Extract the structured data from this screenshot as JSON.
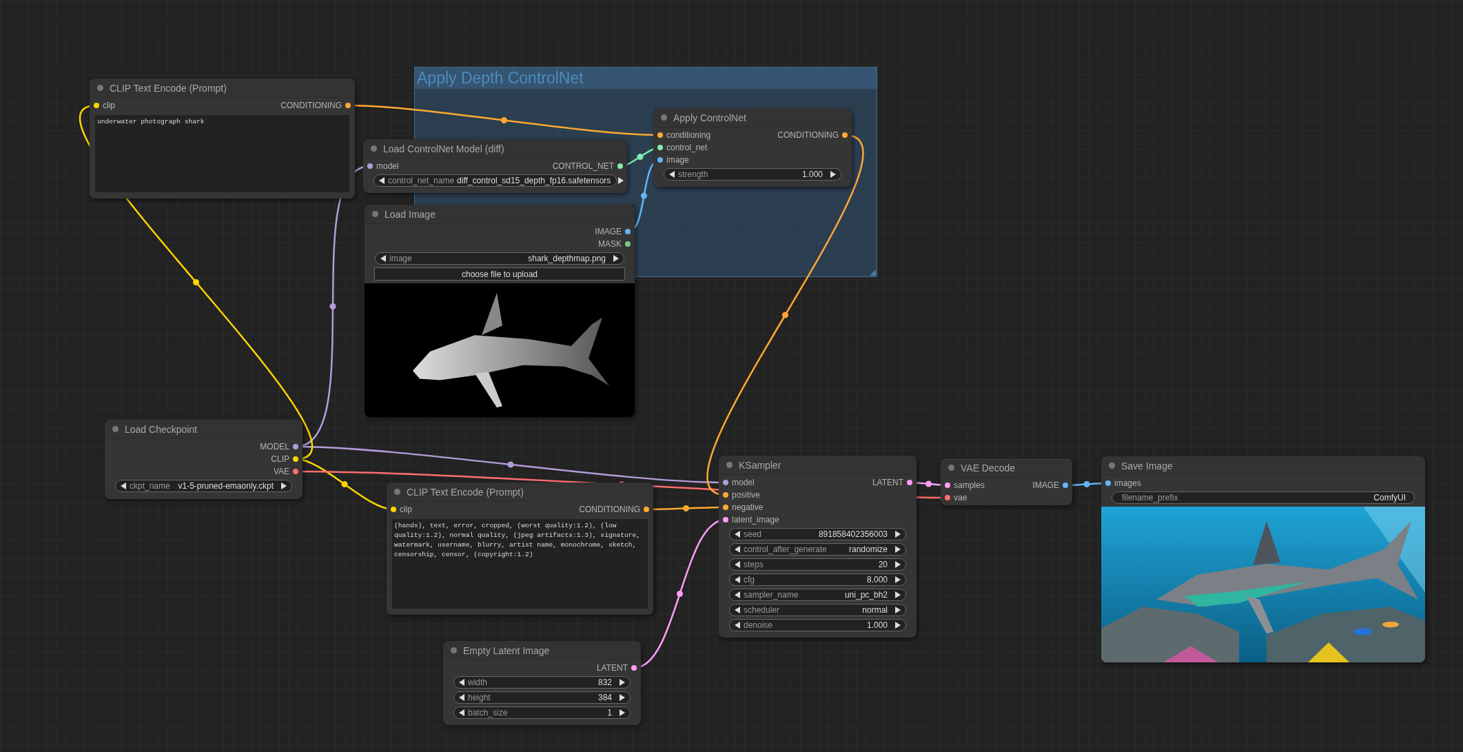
{
  "group": {
    "title": "Apply Depth ControlNet"
  },
  "nodes": [
    {
      "title": "CLIP Text Encode (Prompt)",
      "inputs": [
        {
          "label": "clip",
          "color": "#ffd500"
        }
      ],
      "outputs": [
        {
          "label": "CONDITIONING",
          "color": "#ffa931"
        }
      ],
      "widgets": [
        {
          "kind": "text",
          "value": "underwater photograph shark"
        }
      ]
    },
    {
      "title": "Load ControlNet Model (diff)",
      "inputs": [
        {
          "label": "model",
          "color": "#b39ddb"
        }
      ],
      "outputs": [
        {
          "label": "CONTROL_NET",
          "color": "#7eecb0"
        }
      ],
      "widgets": [
        {
          "kind": "combo",
          "name": "control_net_name",
          "value": "diff_control_sd15_depth_fp16.safetensors"
        }
      ]
    },
    {
      "title": "Apply ControlNet",
      "inputs": [
        {
          "label": "conditioning",
          "color": "#ffa931"
        },
        {
          "label": "control_net",
          "color": "#7eecb0"
        },
        {
          "label": "image",
          "color": "#64b5f6"
        }
      ],
      "outputs": [
        {
          "label": "CONDITIONING",
          "color": "#ffa931"
        }
      ],
      "widgets": [
        {
          "kind": "number",
          "name": "strength",
          "value": "1.000"
        }
      ]
    },
    {
      "title": "Load Image",
      "outputs": [
        {
          "label": "IMAGE",
          "color": "#64b5f6"
        },
        {
          "label": "MASK",
          "color": "#81c784"
        }
      ],
      "widgets": [
        {
          "kind": "combo",
          "name": "image",
          "value": "shark_depthmap.png"
        },
        {
          "kind": "button",
          "label": "choose file to upload"
        },
        {
          "kind": "picture"
        }
      ]
    },
    {
      "title": "Load Checkpoint",
      "outputs": [
        {
          "label": "MODEL",
          "color": "#b39ddb"
        },
        {
          "label": "CLIP",
          "color": "#ffd500"
        },
        {
          "label": "VAE",
          "color": "#ff6e6e"
        }
      ],
      "widgets": [
        {
          "kind": "combo",
          "name": "ckpt_name",
          "value": "v1-5-pruned-emaonly.ckpt"
        }
      ]
    },
    {
      "title": "CLIP Text Encode (Prompt)",
      "inputs": [
        {
          "label": "clip",
          "color": "#ffd500"
        }
      ],
      "outputs": [
        {
          "label": "CONDITIONING",
          "color": "#ffa931"
        }
      ],
      "widgets": [
        {
          "kind": "text",
          "value": "(hands), text, error, cropped, (worst quality:1.2), (low quality:1.2), normal quality, (jpeg artifacts:1.3), signature, watermark, username, blurry, artist name, monochrome, sketch, censorship, censor, (copyright:1.2)"
        }
      ]
    },
    {
      "title": "Empty Latent Image",
      "outputs": [
        {
          "label": "LATENT",
          "color": "#ff9cf9"
        }
      ],
      "widgets": [
        {
          "kind": "number",
          "name": "width",
          "value": "832"
        },
        {
          "kind": "number",
          "name": "height",
          "value": "384"
        },
        {
          "kind": "number",
          "name": "batch_size",
          "value": "1"
        }
      ]
    },
    {
      "title": "KSampler",
      "inputs": [
        {
          "label": "model",
          "color": "#b39ddb"
        },
        {
          "label": "positive",
          "color": "#ffa931"
        },
        {
          "label": "negative",
          "color": "#ffa931"
        },
        {
          "label": "latent_image",
          "color": "#ff9cf9"
        }
      ],
      "outputs": [
        {
          "label": "LATENT",
          "color": "#ff9cf9"
        }
      ],
      "widgets": [
        {
          "kind": "number",
          "name": "seed",
          "value": "891858402356003"
        },
        {
          "kind": "combo",
          "name": "control_after_generate",
          "value": "randomize"
        },
        {
          "kind": "number",
          "name": "steps",
          "value": "20"
        },
        {
          "kind": "number",
          "name": "cfg",
          "value": "8.000"
        },
        {
          "kind": "combo",
          "name": "sampler_name",
          "value": "uni_pc_bh2"
        },
        {
          "kind": "combo",
          "name": "scheduler",
          "value": "normal"
        },
        {
          "kind": "number",
          "name": "denoise",
          "value": "1.000"
        }
      ]
    },
    {
      "title": "VAE Decode",
      "inputs": [
        {
          "label": "samples",
          "color": "#ff9cf9"
        },
        {
          "label": "vae",
          "color": "#ff6e6e"
        }
      ],
      "outputs": [
        {
          "label": "IMAGE",
          "color": "#64b5f6"
        }
      ]
    },
    {
      "title": "Save Image",
      "inputs": [
        {
          "label": "images",
          "color": "#64b5f6"
        }
      ],
      "widgets": [
        {
          "kind": "string",
          "name": "filename_prefix",
          "value": "ComfyUI"
        },
        {
          "kind": "picture"
        }
      ]
    }
  ]
}
